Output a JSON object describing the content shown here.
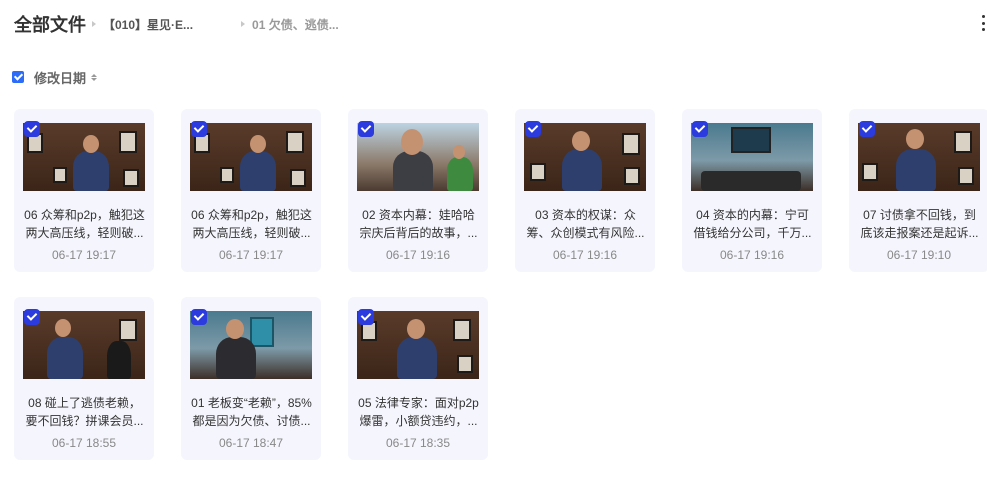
{
  "header": {
    "root_title": "全部文件",
    "crumbs": [
      "【010】星见·E...",
      "01 欠债、逃债..."
    ]
  },
  "sortbar": {
    "label": "修改日期"
  },
  "files": [
    {
      "line1": "06 众筹和p2p，触犯这",
      "line2": "两大高压线，轻则破...",
      "date": "06-17 19:17"
    },
    {
      "line1": "06 众筹和p2p，触犯这",
      "line2": "两大高压线，轻则破...",
      "date": "06-17 19:17"
    },
    {
      "line1": "02 资本内幕：娃哈哈",
      "line2": "宗庆后背后的故事，...",
      "date": "06-17 19:16"
    },
    {
      "line1": "03 资本的权谋：众",
      "line2": "筹、众创模式有风险...",
      "date": "06-17 19:16"
    },
    {
      "line1": "04 资本的内幕：宁可",
      "line2": "借钱给分公司，千万...",
      "date": "06-17 19:16"
    },
    {
      "line1": "07 讨债拿不回钱，到",
      "line2": "底该走报案还是起诉...",
      "date": "06-17 19:10"
    },
    {
      "line1": "08 碰上了逃债老赖，",
      "line2": "要不回钱？拼课会员...",
      "date": "06-17 18:55"
    },
    {
      "line1": "01 老板变“老赖”，85%",
      "line2": "都是因为欠债、讨债...",
      "date": "06-17 18:47"
    },
    {
      "line1": "05 法律专家：面对p2p",
      "line2": "爆雷，小额贷违约，...",
      "date": "06-17 18:35"
    }
  ]
}
